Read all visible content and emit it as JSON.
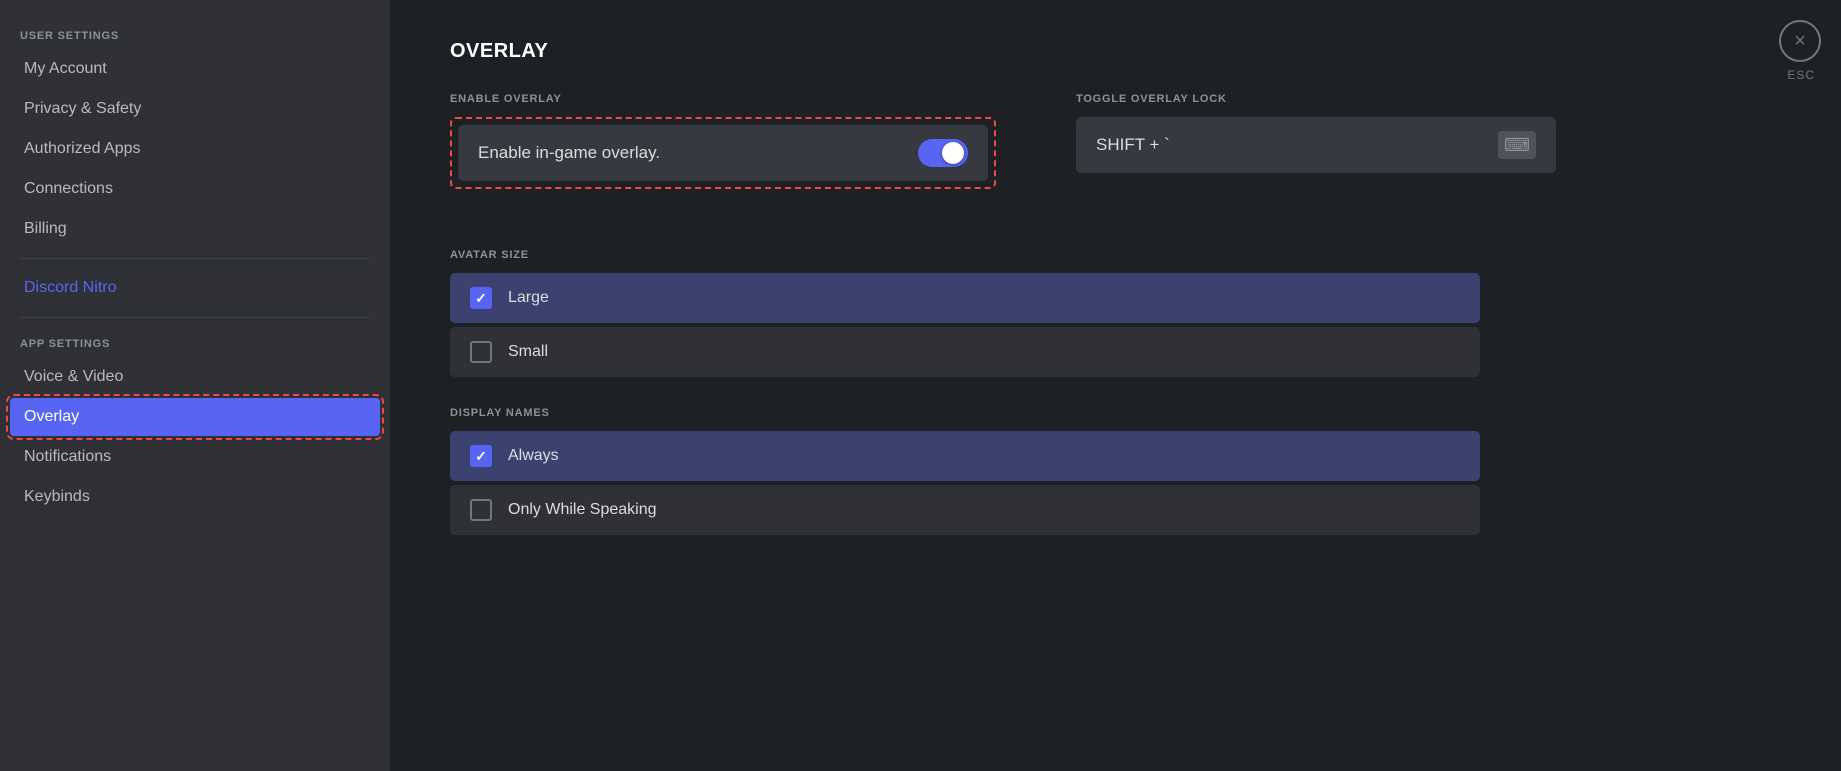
{
  "sidebar": {
    "userSettingsLabel": "USER SETTINGS",
    "appSettingsLabel": "APP SETTINGS",
    "items": [
      {
        "id": "my-account",
        "label": "My Account",
        "active": false,
        "nitro": false
      },
      {
        "id": "privacy-safety",
        "label": "Privacy & Safety",
        "active": false,
        "nitro": false
      },
      {
        "id": "authorized-apps",
        "label": "Authorized Apps",
        "active": false,
        "nitro": false
      },
      {
        "id": "connections",
        "label": "Connections",
        "active": false,
        "nitro": false
      },
      {
        "id": "billing",
        "label": "Billing",
        "active": false,
        "nitro": false
      },
      {
        "id": "discord-nitro",
        "label": "Discord Nitro",
        "active": false,
        "nitro": true
      },
      {
        "id": "voice-video",
        "label": "Voice & Video",
        "active": false,
        "nitro": false
      },
      {
        "id": "overlay",
        "label": "Overlay",
        "active": true,
        "nitro": false
      },
      {
        "id": "notifications",
        "label": "Notifications",
        "active": false,
        "nitro": false
      },
      {
        "id": "keybinds",
        "label": "Keybinds",
        "active": false,
        "nitro": false
      }
    ]
  },
  "main": {
    "pageTitle": "OVERLAY",
    "enableOverlayLabel": "ENABLE OVERLAY",
    "enableOverlayText": "Enable in-game overlay.",
    "toggleOverlayLockLabel": "TOGGLE OVERLAY LOCK",
    "keybindText": "SHIFT + `",
    "avatarSizeLabel": "AVATAR SIZE",
    "avatarOptions": [
      {
        "id": "large",
        "label": "Large",
        "selected": true
      },
      {
        "id": "small",
        "label": "Small",
        "selected": false
      }
    ],
    "displayNamesLabel": "DISPLAY NAMES",
    "displayOptions": [
      {
        "id": "always",
        "label": "Always",
        "selected": true
      },
      {
        "id": "only-while-speaking",
        "label": "Only While Speaking",
        "selected": false
      }
    ]
  },
  "closeButton": "×",
  "escLabel": "ESC"
}
